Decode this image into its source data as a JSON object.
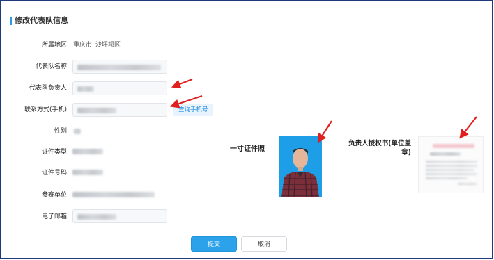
{
  "panel": {
    "title": "修改代表队信息"
  },
  "form": {
    "region_label": "所属地区",
    "region_city": "重庆市",
    "region_district": "沙坪坝区",
    "team_name_label": "代表队名称",
    "leader_label": "代表队负责人",
    "phone_label": "联系方式(手机)",
    "phone_query_button": "查询手机号",
    "gender_label": "性别",
    "id_type_label": "证件类型",
    "id_number_label": "证件号码",
    "unit_label": "参赛单位",
    "email_label": "电子邮箱"
  },
  "photo": {
    "label": "一寸证件照"
  },
  "authorization": {
    "label": "负责人授权书(单位盖章)"
  },
  "actions": {
    "submit": "提交",
    "cancel": "取消"
  },
  "colors": {
    "accent": "#2ba2ea",
    "arrow": "#e02020",
    "photo_bg": "#1e9ee6",
    "border": "#1f3a7a"
  }
}
